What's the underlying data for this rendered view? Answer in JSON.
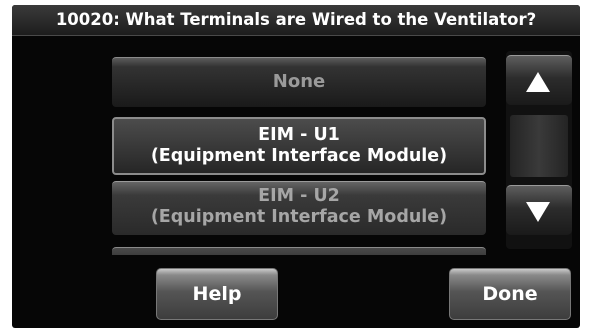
{
  "header": {
    "title": "10020: What Terminals are Wired to the Ventilator?"
  },
  "options": [
    {
      "line1": "None",
      "line2": "",
      "state": "unselected"
    },
    {
      "line1": "EIM - U1",
      "line2": "(Equipment Interface Module)",
      "state": "selected"
    },
    {
      "line1": "EIM - U2",
      "line2": "(Equipment Interface Module)",
      "state": "unselected"
    }
  ],
  "scrollbar": {
    "up_icon": "up-arrow-icon",
    "down_icon": "down-arrow-icon"
  },
  "footer": {
    "help_label": "Help",
    "done_label": "Done"
  }
}
